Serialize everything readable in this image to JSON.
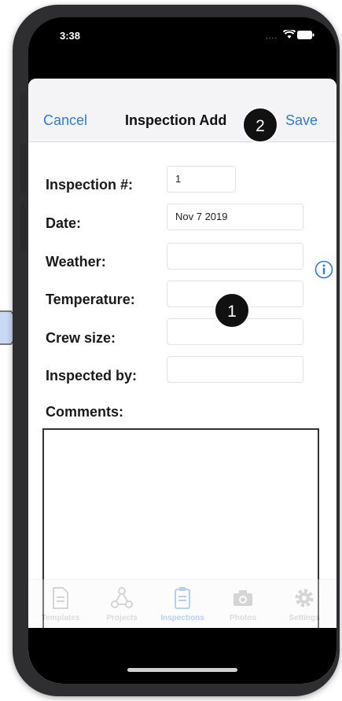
{
  "status_bar": {
    "time": "3:38",
    "signal": "...."
  },
  "nav": {
    "cancel_label": "Cancel",
    "title": "Inspection Add",
    "save_label": "Save"
  },
  "form": {
    "fields": [
      {
        "label": "Inspection #:",
        "value": "1"
      },
      {
        "label": "Date:",
        "value": "Nov 7 2019"
      },
      {
        "label": "Weather:",
        "value": ""
      },
      {
        "label": "Temperature:",
        "value": ""
      },
      {
        "label": "Crew size:",
        "value": ""
      },
      {
        "label": "Inspected by:",
        "value": ""
      }
    ],
    "comments_label": "Comments:",
    "comments_value": ""
  },
  "tabs": [
    {
      "label": "Templates",
      "icon": "document-icon",
      "active": false
    },
    {
      "label": "Projects",
      "icon": "network-icon",
      "active": false
    },
    {
      "label": "Inspections",
      "icon": "clipboard-icon",
      "active": true
    },
    {
      "label": "Photos",
      "icon": "camera-icon",
      "active": false
    },
    {
      "label": "Settings",
      "icon": "gear-icon",
      "active": false
    }
  ],
  "callouts": {
    "one": "1",
    "two": "2"
  },
  "colors": {
    "accent": "#2f7bd9",
    "phone_body": "#2e2e30",
    "callout": "#111111"
  }
}
